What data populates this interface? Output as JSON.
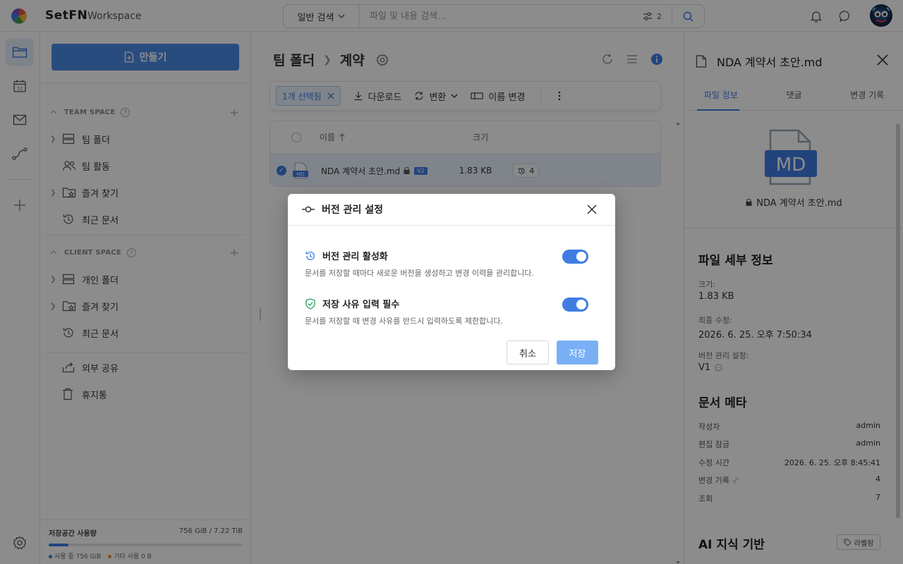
{
  "app": {
    "brand": "SetFN",
    "workspace": "Workspace"
  },
  "search": {
    "mode": "일반 검색",
    "placeholder": "파일 및 내용 검색...",
    "filter_count": "2"
  },
  "sidebar": {
    "create_label": "만들기",
    "team_space": {
      "title": "TEAM SPACE",
      "items": [
        "팀 폴더",
        "팀 활동",
        "즐겨 찾기",
        "최근 문서"
      ]
    },
    "client_space": {
      "title": "CLIENT SPACE",
      "items": [
        "개인 폴더",
        "즐겨 찾기",
        "최근 문서"
      ]
    },
    "extra": [
      "외부 공유",
      "휴지통"
    ],
    "storage": {
      "title": "저장공간 사용량",
      "value": "756 GiB / 7.22 TiB",
      "used": "사용 중 756 GiB",
      "other": "기타 사용 0 B",
      "fill_fraction": 0.1
    }
  },
  "main": {
    "breadcrumb": [
      "팀 폴더",
      "계약"
    ],
    "actions": {
      "selected": "1개 선택됨",
      "download": "다운로드",
      "convert": "변환",
      "rename": "이름 변경"
    },
    "table": {
      "headers": {
        "name": "이름",
        "size": "크기"
      },
      "rows": [
        {
          "name": "NDA 계약서 초안.md",
          "badge": "V2",
          "size": "1.83 KB",
          "history": "4"
        }
      ]
    }
  },
  "panel": {
    "title": "NDA 계약서 초안.md",
    "tabs": [
      "파일 정보",
      "댓글",
      "변경 기록"
    ],
    "icon_text": "MD",
    "file_name": "NDA 계약서 초안.md",
    "details_heading": "파일 세부 정보",
    "size_label": "크기:",
    "size_value": "1.83 KB",
    "modified_label": "최종 수정:",
    "modified_value": "2026. 6. 25. 오후 7:50:34",
    "version_label": "버전 관리 설정:",
    "version_value": "V1",
    "meta_heading": "문서 메타",
    "meta": [
      {
        "k": "작성자",
        "v": "admin"
      },
      {
        "k": "편집 잠금",
        "v": "admin"
      },
      {
        "k": "수정 시간",
        "v": "2026. 6. 25. 오후 8:45:41"
      },
      {
        "k": "변경 기록",
        "v": "4"
      },
      {
        "k": "조회",
        "v": "7"
      }
    ],
    "ai_heading": "AI 지식 기반",
    "label_btn": "라벨링"
  },
  "modal": {
    "title": "버전 관리 설정",
    "opt1_title": "버전 관리 활성화",
    "opt1_desc": "문서를 저장할 때마다 새로운 버전을 생성하고 변경 이력을 관리합니다.",
    "opt2_title": "저장 사유 입력 필수",
    "opt2_desc": "문서를 저장할 때 변경 사유를 반드시 입력하도록 제한합니다.",
    "cancel": "취소",
    "save": "저장"
  },
  "colors": {
    "accent": "#3f7de3",
    "save_button": "#79b0f5",
    "overlay": "rgba(0,0,0,0.45)"
  }
}
